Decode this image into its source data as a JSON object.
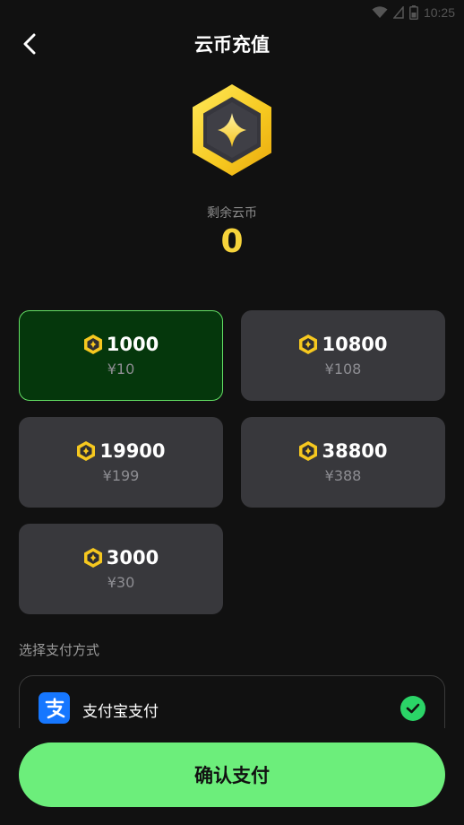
{
  "status_bar": {
    "time": "10:25",
    "icons": [
      "wifi-icon",
      "signal-icon",
      "battery-icon"
    ]
  },
  "header": {
    "title": "云币充值",
    "back_icon": "back-arrow-icon"
  },
  "balance": {
    "label": "剩余云币",
    "value": "0"
  },
  "packages": [
    {
      "coins": "1000",
      "price": "¥10",
      "selected": true
    },
    {
      "coins": "10800",
      "price": "¥108",
      "selected": false
    },
    {
      "coins": "19900",
      "price": "¥199",
      "selected": false
    },
    {
      "coins": "38800",
      "price": "¥388",
      "selected": false
    },
    {
      "coins": "3000",
      "price": "¥30",
      "selected": false
    }
  ],
  "payment": {
    "section_label": "选择支付方式",
    "method_label": "支付宝支付",
    "method_icon": "alipay-icon",
    "selected": true
  },
  "confirm_button": "确认支付",
  "colors": {
    "background": "#111111",
    "card": "#38383c",
    "selected_card": "#05370c",
    "selected_border": "#63e064",
    "coin_gold": "#f6d33b",
    "confirm_green": "#6cee7b",
    "check_green": "#2bd467",
    "alipay_blue": "#1677ff"
  }
}
